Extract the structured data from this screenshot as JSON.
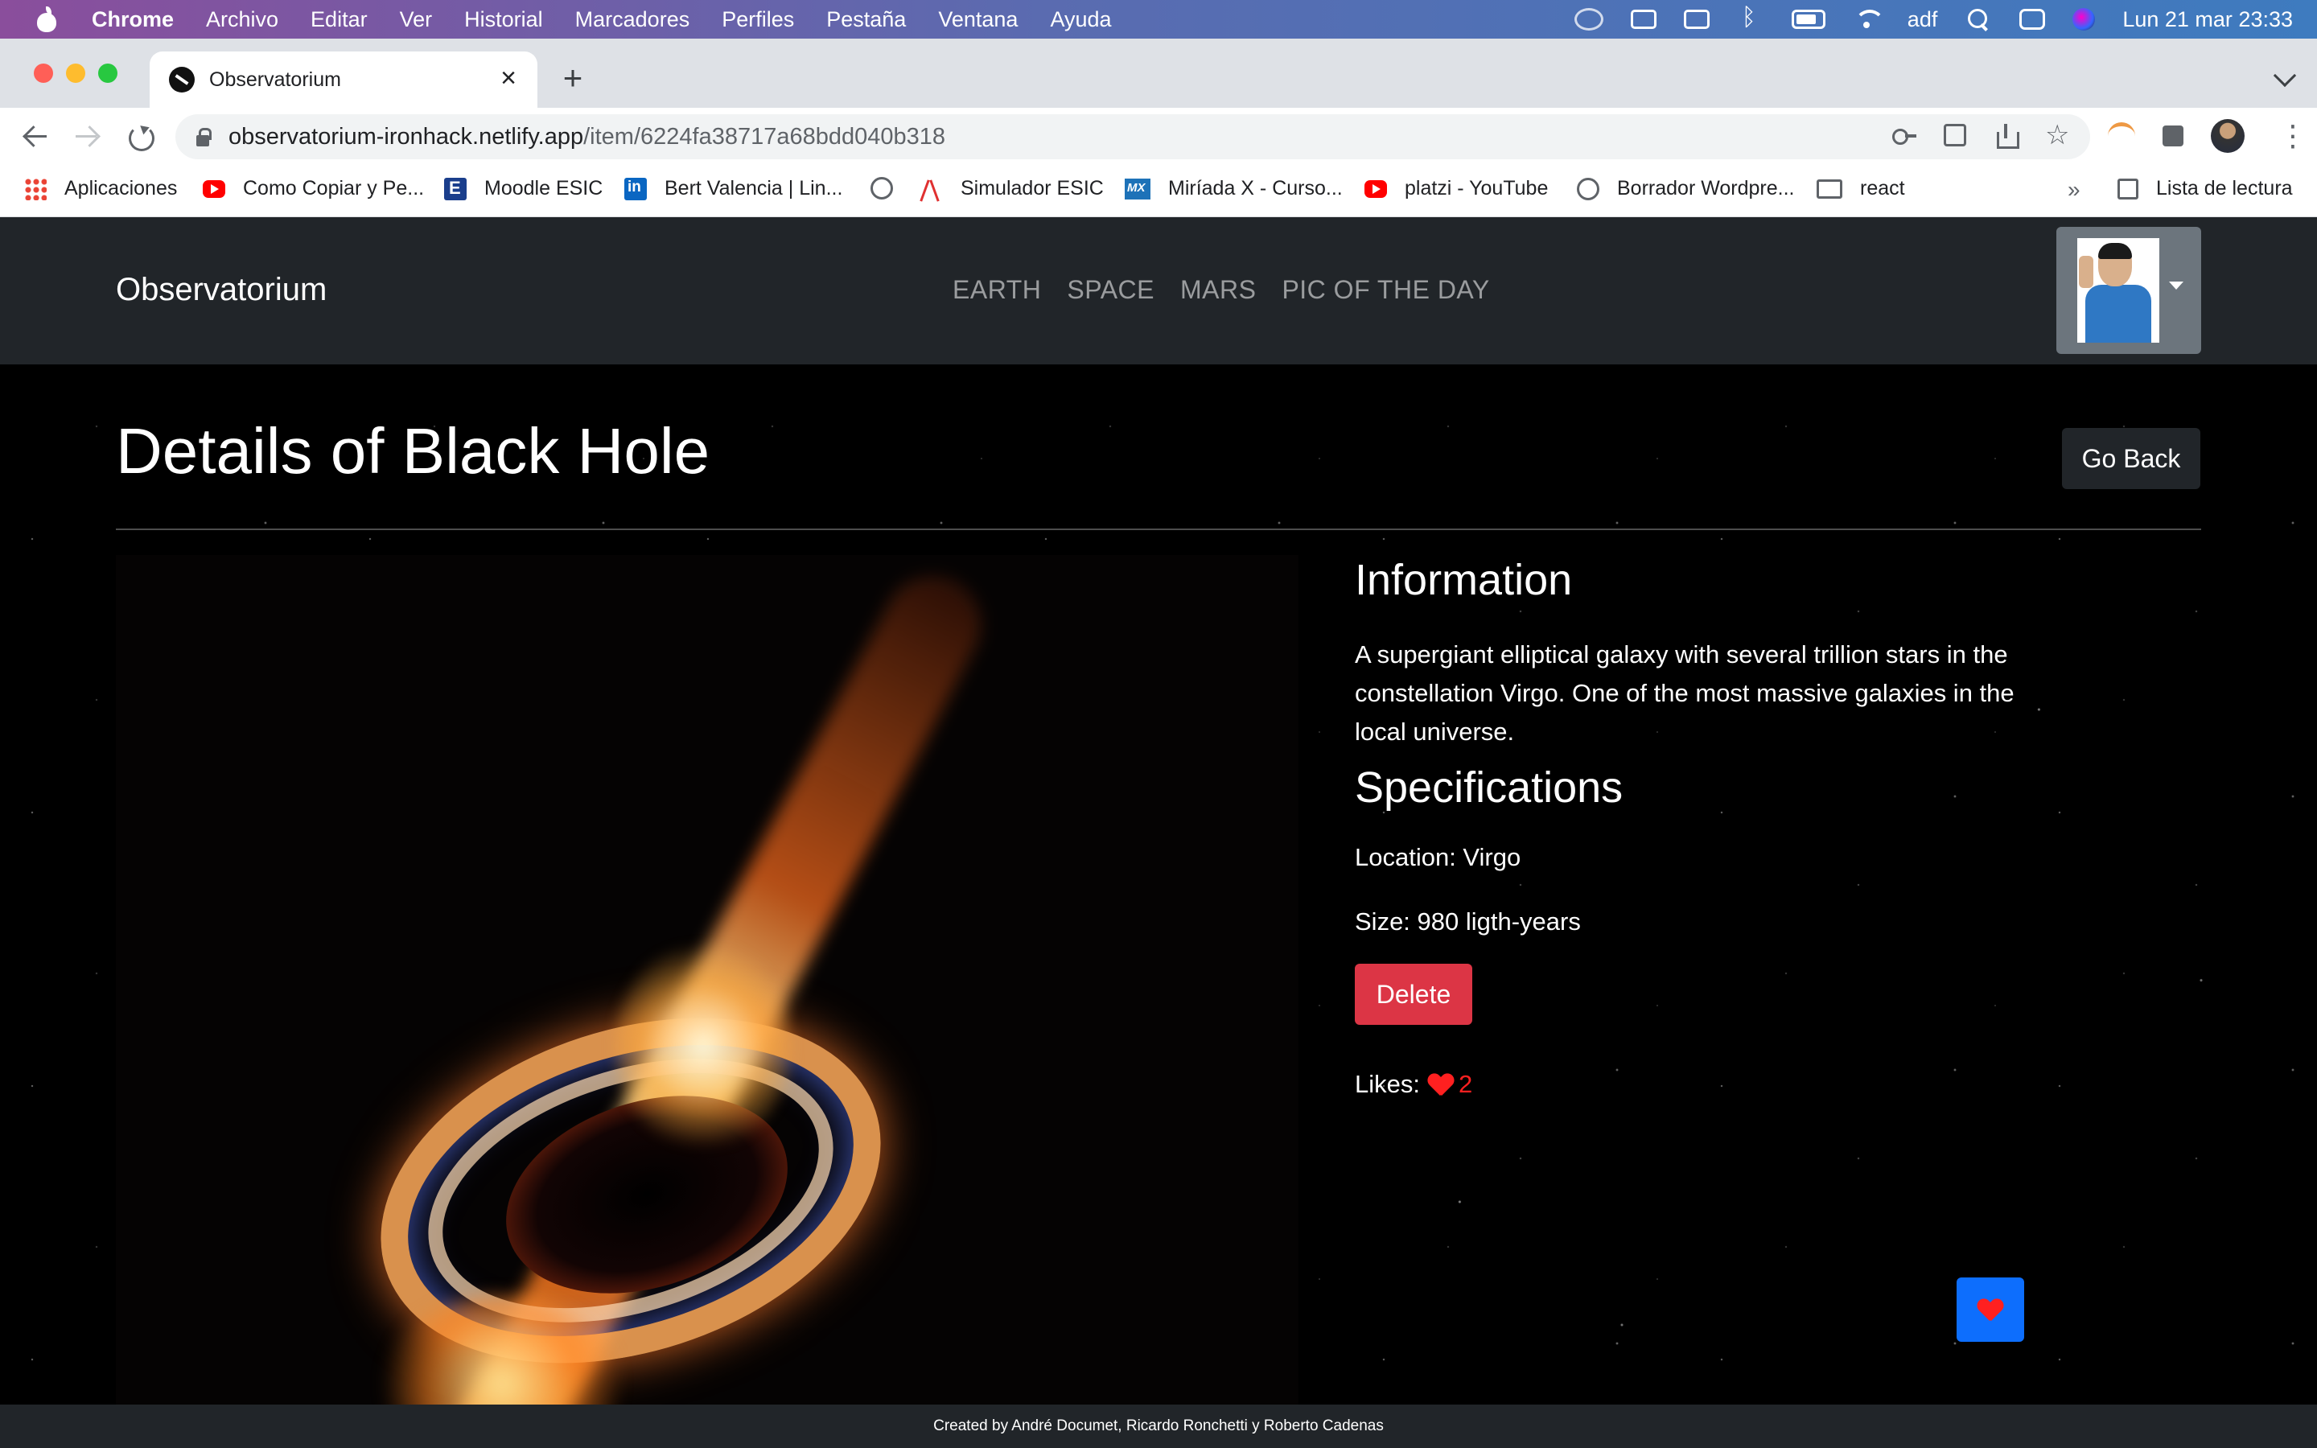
{
  "menubar": {
    "app_name": "Chrome",
    "items": [
      "Archivo",
      "Editar",
      "Ver",
      "Historial",
      "Marcadores",
      "Perfiles",
      "Pestaña",
      "Ventana",
      "Ayuda"
    ],
    "user": "adf",
    "datetime": "Lun 21 mar  23:33"
  },
  "browser": {
    "tab_title": "Observatorium",
    "url_host": "observatorium-ironhack.netlify.app",
    "url_path": "/item/6224fa38717a68bdd040b318",
    "bookmarks": [
      {
        "label": "Aplicaciones",
        "icon": "apps-icon"
      },
      {
        "label": "Como Copiar y Pe...",
        "icon": "youtube-icon"
      },
      {
        "label": "Moodle ESIC",
        "icon": "esic-icon"
      },
      {
        "label": "Bert Valencia | Lin...",
        "icon": "linkedin-icon"
      },
      {
        "label": "",
        "icon": "globe-icon"
      },
      {
        "label": "Simulador ESIC",
        "icon": "simulador-icon"
      },
      {
        "label": "Miríada X - Curso...",
        "icon": "miriadax-icon"
      },
      {
        "label": "platzi - YouTube",
        "icon": "youtube-icon"
      },
      {
        "label": "Borrador Wordpre...",
        "icon": "globe-icon"
      },
      {
        "label": "react",
        "icon": "folder-icon"
      }
    ],
    "overflow": "»",
    "reading_list": "Lista de lectura"
  },
  "site": {
    "brand": "Observatorium",
    "nav": [
      "EARTH",
      "SPACE",
      "MARS",
      "PIC OF THE DAY"
    ],
    "title": "Details of Black Hole",
    "go_back": "Go Back",
    "info_heading": "Information",
    "description": "A supergiant elliptical galaxy with several trillion stars in the constellation Virgo. One of the most massive galaxies in the local universe.",
    "spec_heading": "Specifications",
    "location": "Location: Virgo",
    "size": "Size: 980 ligth-years",
    "delete": "Delete",
    "likes_label": "Likes:",
    "likes_count": "2",
    "footer": "Created by André Documet, Ricardo Ronchetti y Roberto Cadenas"
  },
  "colors": {
    "navbar": "#212529",
    "delete": "#dc3545",
    "like_button": "#0d6efd",
    "heart": "#ff2020"
  }
}
